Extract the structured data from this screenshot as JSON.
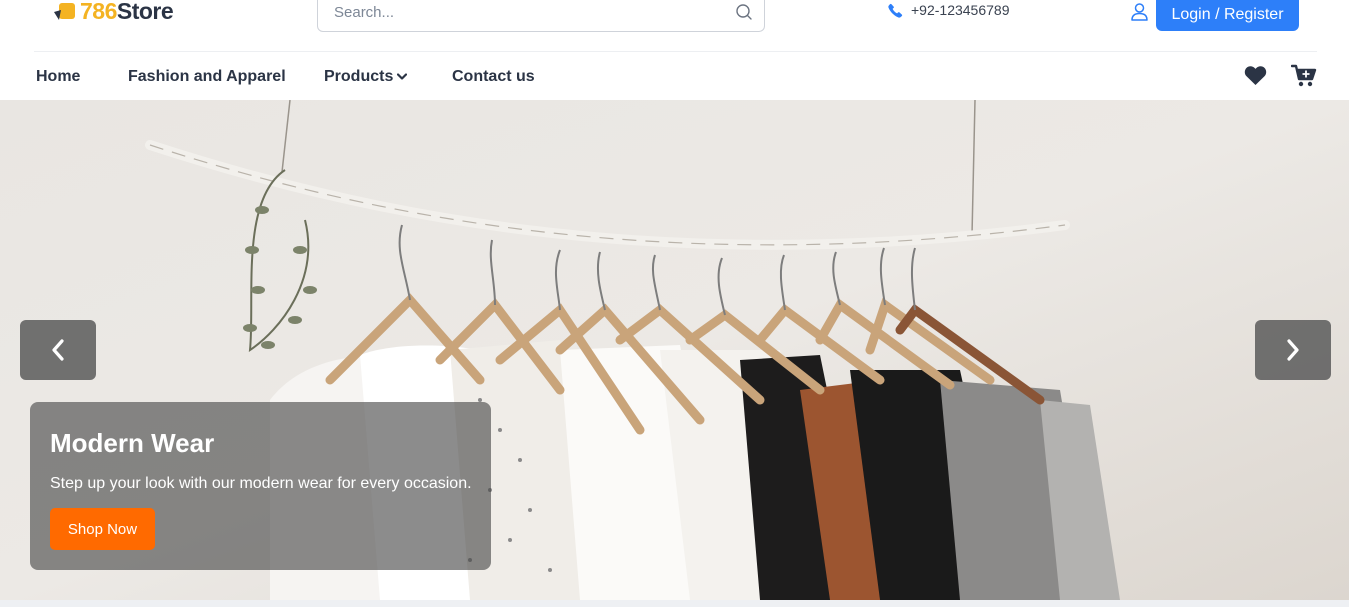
{
  "header": {
    "logo": {
      "number": "786",
      "word": "Store"
    },
    "search": {
      "placeholder": "Search..."
    },
    "phone": "+92-123456789",
    "login_label": "Login / Register"
  },
  "nav": {
    "items": [
      {
        "label": "Home"
      },
      {
        "label": "Fashion and Apparel"
      },
      {
        "label": "Products"
      },
      {
        "label": "Contact us"
      }
    ]
  },
  "hero": {
    "title": "Modern Wear",
    "subtitle": "Step up your look with our modern wear for every occasion.",
    "cta_label": "Shop Now"
  },
  "colors": {
    "accent_blue": "#2d7ff9",
    "cta_orange": "#ff6a00",
    "logo_yellow": "#f4b322",
    "text_dark": "#2b3445"
  },
  "icons": [
    "logo-bag-icon",
    "search-icon",
    "phone-icon",
    "user-icon",
    "chevron-down-icon",
    "heart-icon",
    "cart-icon",
    "chevron-left-icon",
    "chevron-right-icon"
  ]
}
